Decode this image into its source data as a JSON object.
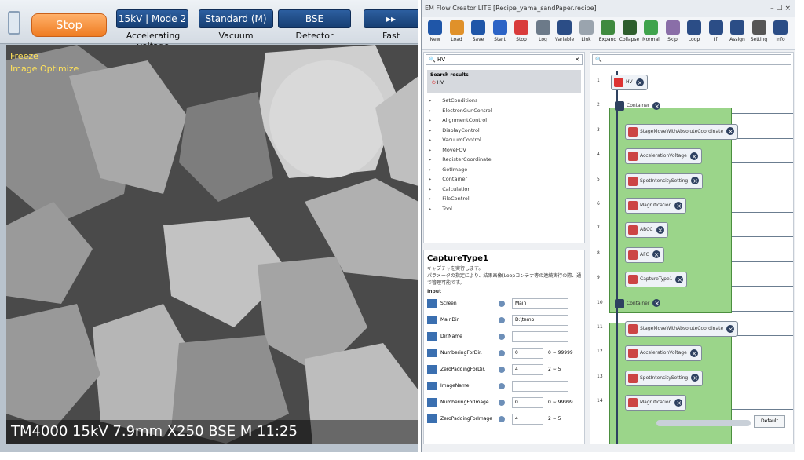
{
  "sem": {
    "stop_label": "Stop",
    "hv_value": "15kV | Mode 2",
    "hv_caption": "Accelerating voltage",
    "vacuum_value": "Standard (M)",
    "vacuum_caption": "Vacuum",
    "detector_value": "BSE",
    "detector_caption": "Detector",
    "scan_value": "▸▸",
    "scan_caption": "Fast",
    "overlay_freeze": "Freeze",
    "overlay_optimize": "Image Optimize",
    "info_text": "TM4000 15kV 7.9mm X250 BSE M 11:25"
  },
  "app": {
    "title": "EM Flow Creator LITE  [Recipe_yama_sandPaper.recipe]",
    "win_controls": "–  ☐  ×",
    "toolbar": [
      {
        "label": "New",
        "color": "#1f56a8"
      },
      {
        "label": "Load",
        "color": "#e0912a"
      },
      {
        "label": "Save",
        "color": "#1f56a8"
      },
      {
        "label": "Start",
        "color": "#2b63c6"
      },
      {
        "label": "Stop",
        "color": "#d93b3b"
      },
      {
        "label": "Log",
        "color": "#6c7a89"
      },
      {
        "label": "Variable",
        "color": "#2b4d86"
      },
      {
        "label": "Link",
        "color": "#9aa4ae"
      },
      {
        "label": "Expand",
        "color": "#3f8a3f"
      },
      {
        "label": "Collapse",
        "color": "#2e5e2e"
      },
      {
        "label": "Normal",
        "color": "#3fa34d"
      },
      {
        "label": "Skip",
        "color": "#8a6ea8"
      },
      {
        "label": "Loop",
        "color": "#2b4d86"
      },
      {
        "label": "If",
        "color": "#2b4d86"
      },
      {
        "label": "Assign",
        "color": "#2b4d86"
      },
      {
        "label": "Setting",
        "color": "#555"
      },
      {
        "label": "Info",
        "color": "#2b4d86"
      }
    ],
    "search_left": "HV",
    "search_results_title": "Search results",
    "search_hit": "HV",
    "tree_items": [
      "SetConditions",
      "ElectronGunControl",
      "AlignmentControl",
      "DisplayControl",
      "VacuumControl",
      "MoveFOV",
      "RegisterCoordinate",
      "GetImage",
      "Container",
      "Calculation",
      "FileControl",
      "Tool"
    ],
    "prop_title": "CaptureType1",
    "prop_desc1": "キャプチャを実行します。",
    "prop_desc2": "パラメータの指定により、結果画像(Loopコンテナ等の連続実行の際、通",
    "prop_desc3": "で管理可能です。",
    "input_header": "Input",
    "params": [
      {
        "name": "Screen",
        "value": "Main",
        "range": ""
      },
      {
        "name": "MainDir.",
        "value": "D:\\temp",
        "range": ""
      },
      {
        "name": "Dir.Name",
        "value": "",
        "range": ""
      },
      {
        "name": "NumberingForDir.",
        "value": "0",
        "range": "0 ~ 99999"
      },
      {
        "name": "ZeroPaddingForDir.",
        "value": "4",
        "range": "2 ~ 5"
      },
      {
        "name": "ImageName",
        "value": "",
        "range": ""
      },
      {
        "name": "NumberingForImage",
        "value": "0",
        "range": "0 ~ 99999"
      },
      {
        "name": "ZeroPaddingForImage",
        "value": "4",
        "range": "2 ~ 5"
      }
    ],
    "flow": {
      "nodes": [
        {
          "no": "1",
          "label": "HV"
        },
        {
          "no": "2",
          "label": "Container"
        },
        {
          "no": "3",
          "label": "StageMoveWithAbsoluteCoordinate"
        },
        {
          "no": "4",
          "label": "AccelerationVoltage"
        },
        {
          "no": "5",
          "label": "SpotIntensitySetting"
        },
        {
          "no": "6",
          "label": "Magnification"
        },
        {
          "no": "7",
          "label": "ABCC"
        },
        {
          "no": "8",
          "label": "AFC"
        },
        {
          "no": "9",
          "label": "CaptureType1"
        },
        {
          "no": "10",
          "label": "Container"
        },
        {
          "no": "11",
          "label": "StageMoveWithAbsoluteCoordinate"
        },
        {
          "no": "12",
          "label": "AccelerationVoltage"
        },
        {
          "no": "13",
          "label": "SpotIntensitySetting"
        },
        {
          "no": "14",
          "label": "Magnification"
        }
      ],
      "zoom_label": "Default"
    }
  }
}
